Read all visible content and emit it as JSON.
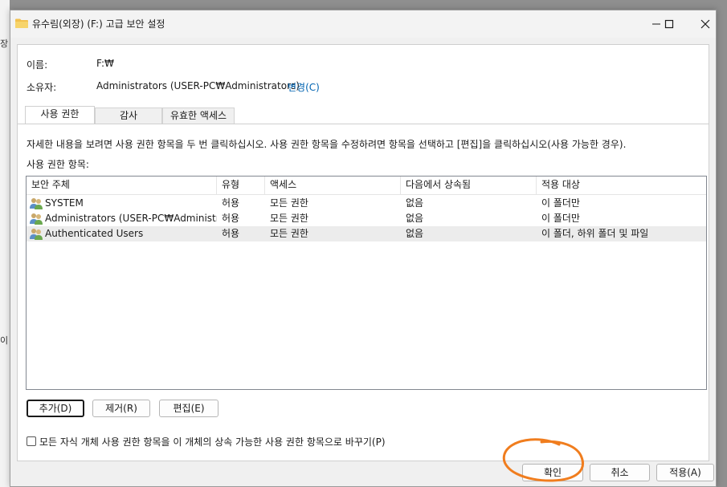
{
  "background": {
    "glyph_top": "장",
    "glyph_bottom": "이"
  },
  "window": {
    "title": "유수림(외장) (F:) 고급 보안 설정",
    "minimize_icon": "minimize-icon",
    "maximize_icon": "maximize-icon",
    "close_icon": "close-icon"
  },
  "info": {
    "name_label": "이름:",
    "name_value": "F:₩",
    "owner_label": "소유자:",
    "owner_value": "Administrators (USER-PC₩Administrators)",
    "change_link": "변경(C)"
  },
  "tabs": [
    {
      "label": "사용 권한",
      "active": true
    },
    {
      "label": "감사",
      "active": false
    },
    {
      "label": "유효한 액세스",
      "active": false
    }
  ],
  "permissions": {
    "description": "자세한 내용을 보려면 사용 권한 항목을 두 번 클릭하십시오. 사용 권한 항목을 수정하려면 항목을 선택하고 [편집]을 클릭하십시오(사용 가능한 경우).",
    "entries_label": "사용 권한 항목:",
    "columns": [
      "보안 주체",
      "유형",
      "액세스",
      "다음에서 상속됨",
      "적용 대상"
    ],
    "rows": [
      {
        "principal": "SYSTEM",
        "type": "허용",
        "access": "모든 권한",
        "inherited": "없음",
        "applies": "이 폴더만",
        "selected": false
      },
      {
        "principal": "Administrators (USER-PC₩Administra...",
        "type": "허용",
        "access": "모든 권한",
        "inherited": "없음",
        "applies": "이 폴더만",
        "selected": false
      },
      {
        "principal": "Authenticated Users",
        "type": "허용",
        "access": "모든 권한",
        "inherited": "없음",
        "applies": "이 폴더, 하위 폴더 및 파일",
        "selected": true
      }
    ],
    "add_button": "추가(D)",
    "remove_button": "제거(R)",
    "edit_button": "편집(E)",
    "replace_checkbox_label": "모든 자식 개체 사용 권한 항목을 이 개체의 상속 가능한 사용 권한 항목으로 바꾸기(P)",
    "replace_checked": false
  },
  "footer": {
    "ok_button": "확인",
    "cancel_button": "취소",
    "apply_button": "적용(A)"
  },
  "colors": {
    "link": "#0063b1",
    "annotation": "#f07d1e",
    "selected_row": "#ececec"
  }
}
